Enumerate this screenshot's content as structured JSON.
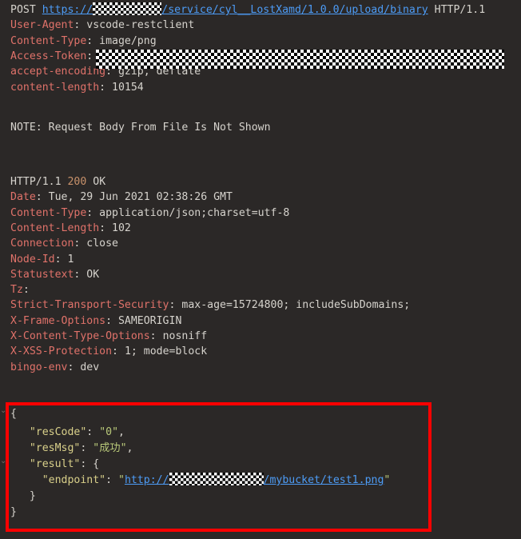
{
  "editor": {
    "background_color": "#2b2827",
    "header_name_color": "#e0726a",
    "text_color": "#d6d3cd",
    "link_color": "#4d9cf6",
    "json_key_color": "#d9d08a",
    "json_string_color": "#b9c97a",
    "status_code_color": "#c9926b",
    "highlight_border_color": "#fe0000"
  },
  "request": {
    "method": "POST",
    "url_visible_prefix": "https://",
    "url_redacted": "[REDACTED]",
    "url_path": "/service/cyl__LostXamd/1.0.0/upload/binary",
    "protocol": "HTTP/1.1",
    "headers": [
      {
        "name": "User-Agent",
        "sep": ": ",
        "value": "vscode-restclient"
      },
      {
        "name": "Content-Type",
        "sep": ": ",
        "value": "image/png"
      },
      {
        "name": "Access-Token",
        "sep": ": ",
        "value": "[REDACTED]"
      },
      {
        "name": "accept-encoding",
        "sep": ": ",
        "value": "gzip, deflate"
      },
      {
        "name": "content-length",
        "sep": ": ",
        "value": "10154"
      }
    ],
    "body_note": "NOTE: Request Body From File Is Not Shown"
  },
  "response": {
    "status_line": {
      "protocol": "HTTP/1.1",
      "code": "200",
      "text": "OK"
    },
    "headers": [
      {
        "name": "Date",
        "sep": ": ",
        "value": "Tue, 29 Jun 2021 02:38:26 GMT"
      },
      {
        "name": "Content-Type",
        "sep": ": ",
        "value": "application/json;charset=utf-8"
      },
      {
        "name": "Content-Length",
        "sep": ": ",
        "value": "102"
      },
      {
        "name": "Connection",
        "sep": ": ",
        "value": "close"
      },
      {
        "name": "Node-Id",
        "sep": ": ",
        "value": "1"
      },
      {
        "name": "Statustext",
        "sep": ": ",
        "value": "OK"
      },
      {
        "name": "Tz",
        "sep": ":",
        "value": ""
      },
      {
        "name": "Strict-Transport-Security",
        "sep": ": ",
        "value": "max-age=15724800; includeSubDomains;"
      },
      {
        "name": "X-Frame-Options",
        "sep": ": ",
        "value": "SAMEORIGIN"
      },
      {
        "name": "X-Content-Type-Options",
        "sep": ": ",
        "value": "nosniff"
      },
      {
        "name": "X-XSS-Protection",
        "sep": ": ",
        "value": "1; mode=block"
      },
      {
        "name": "bingo-env",
        "sep": ": ",
        "value": "dev"
      }
    ],
    "body": {
      "open_brace": "{",
      "res_code_key": "\"resCode\"",
      "res_code_sep": ": ",
      "res_code_value": "\"0\"",
      "res_code_comma": ",",
      "res_msg_key": "\"resMsg\"",
      "res_msg_sep": ": ",
      "res_msg_value": "\"成功\"",
      "res_msg_comma": ",",
      "result_key": "\"result\"",
      "result_sep": ": ",
      "result_open_brace": "{",
      "endpoint_key": "\"endpoint\"",
      "endpoint_sep": ": ",
      "endpoint_quote_open": "\"",
      "endpoint_url_prefix": "http://",
      "endpoint_url_redacted": "[REDACTED]",
      "endpoint_url_suffix": "/mybucket/test1.png",
      "endpoint_quote_close": "\"",
      "result_close_brace": "}",
      "close_brace": "}"
    }
  },
  "fold_markers": {
    "glyph": "⌄"
  }
}
